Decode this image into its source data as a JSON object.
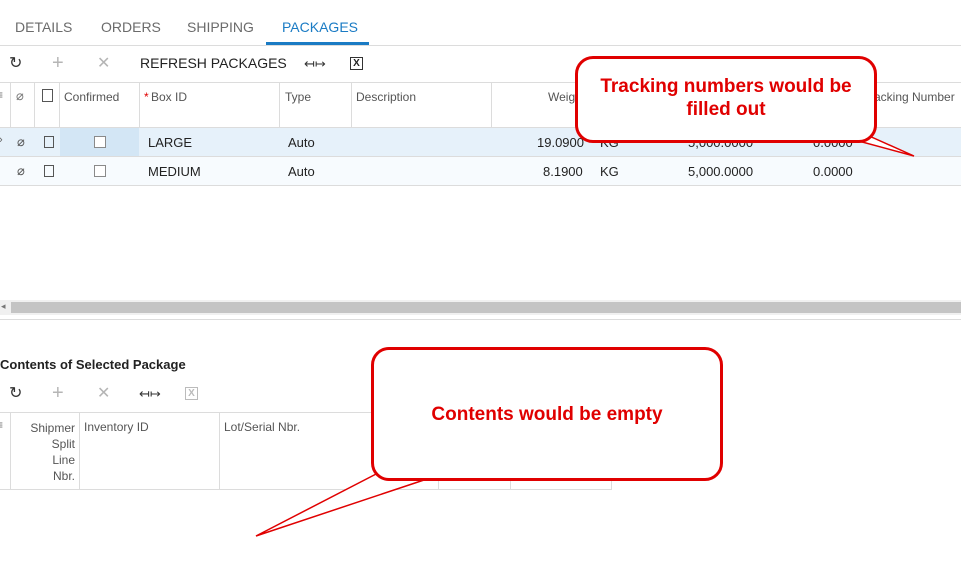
{
  "tabs": [
    {
      "label": "DETAILS",
      "active": false
    },
    {
      "label": "ORDERS",
      "active": false
    },
    {
      "label": "SHIPPING",
      "active": false
    },
    {
      "label": "PACKAGES",
      "active": true
    }
  ],
  "packages_toolbar": {
    "refresh_icon": "refresh-icon",
    "add_icon": "plus-icon",
    "delete_icon": "close-icon",
    "refresh_packages_label": "REFRESH PACKAGES",
    "fit_icon": "fit-columns-icon",
    "excel_icon": "excel-icon"
  },
  "packages_grid": {
    "columns": {
      "confirmed": "Confirmed",
      "box_id_required": "*",
      "box_id": "Box ID",
      "type": "Type",
      "description": "Description",
      "weight": "Weig",
      "tracking_number": "racking Number"
    },
    "rows": [
      {
        "box_id": "LARGE",
        "type": "Auto",
        "weight": "19.0900",
        "uom": "KG",
        "declared_value": "5,000.0000",
        "cod": "0.0000"
      },
      {
        "box_id": "MEDIUM",
        "type": "Auto",
        "weight": "8.1900",
        "uom": "KG",
        "declared_value": "5,000.0000",
        "cod": "0.0000"
      }
    ]
  },
  "contents_section": {
    "title": "Contents of Selected Package",
    "columns": {
      "shipment_split_line_nbr": [
        "Shipmer",
        "Split",
        "Line",
        "Nbr."
      ],
      "inventory_id": "Inventory ID",
      "lot_serial_nbr": "Lot/Serial Nbr."
    }
  },
  "annotations": {
    "tracking": "Tracking numbers would be filled out",
    "contents": "Contents would be empty"
  },
  "colors": {
    "accent": "#1a7bc4",
    "callout": "#e00000",
    "selected_row": "#e6f1fa"
  }
}
